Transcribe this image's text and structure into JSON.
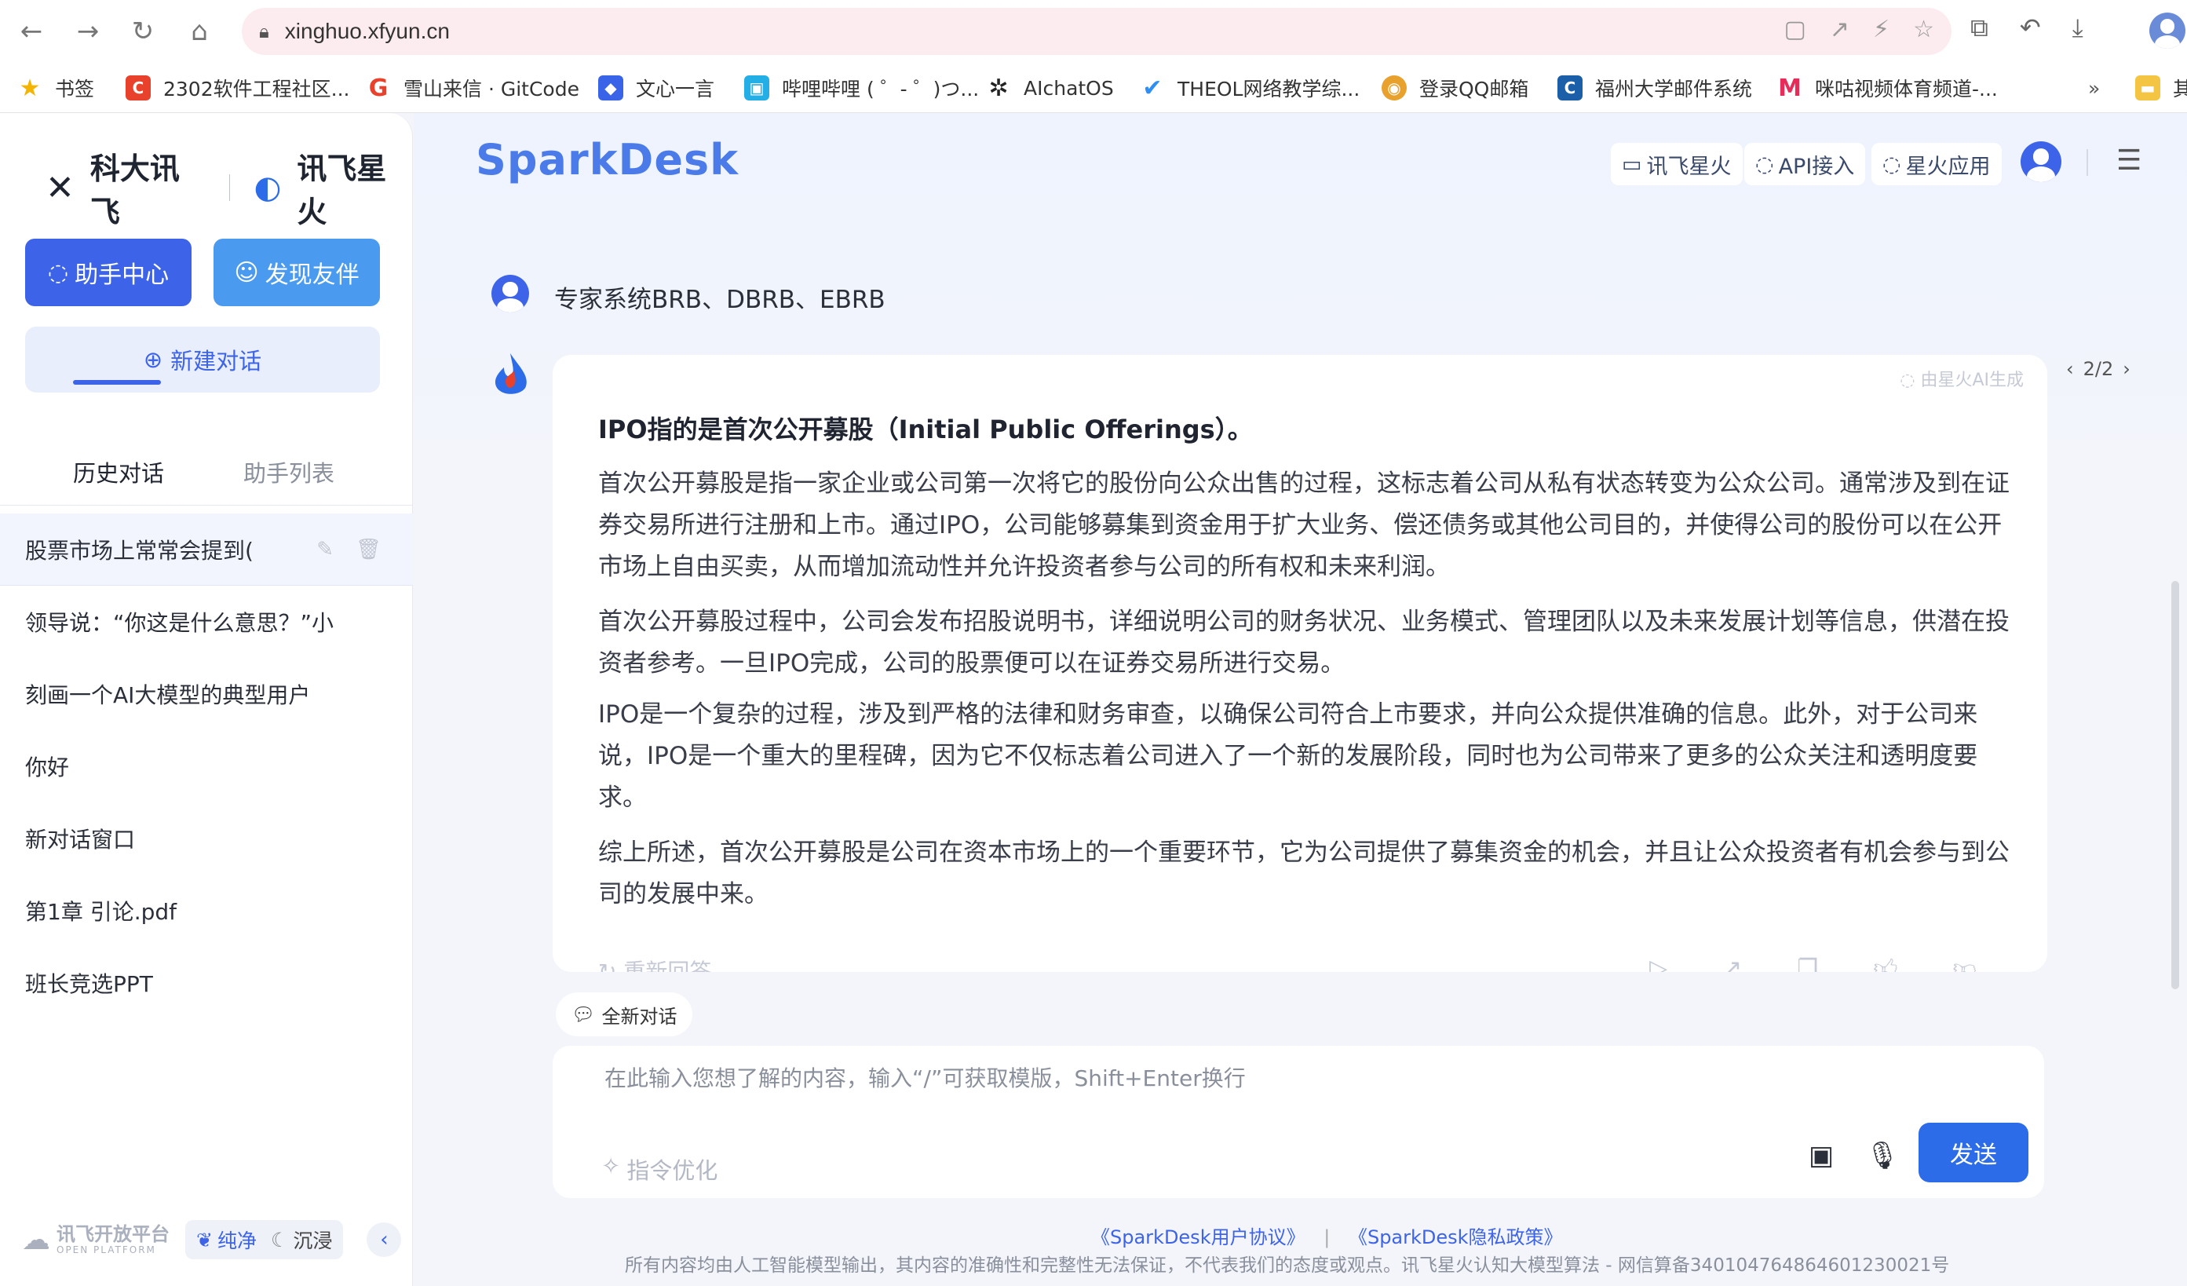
{
  "browser": {
    "url": "xinghuo.xfyun.cn",
    "bookmarks": [
      {
        "label": "书签",
        "icon": "star-icon",
        "color": "#f4b400"
      },
      {
        "label": "2302软件工程社区...",
        "icon": "c-logo-icon",
        "color": "#e8412c"
      },
      {
        "label": "雪山来信 · GitCode",
        "icon": "g-logo-icon",
        "color": "#e8412c"
      },
      {
        "label": "文心一言",
        "icon": "cube-icon",
        "color": "#3a64e8"
      },
      {
        "label": "哔哩哔哩 ( ゜- ゜)つ...",
        "icon": "bilibili-icon",
        "color": "#23aee5"
      },
      {
        "label": "AIchatOS",
        "icon": "openai-icon",
        "color": "#222222"
      },
      {
        "label": "THEOL网络教学综...",
        "icon": "check-icon",
        "color": "#2d8ef5"
      },
      {
        "label": "登录QQ邮箱",
        "icon": "chrome-icon",
        "color": "#e8a12c"
      },
      {
        "label": "福州大学邮件系统",
        "icon": "c-logo-icon",
        "color": "#1a5fa8"
      },
      {
        "label": "咪咕视频体育频道-...",
        "icon": "migu-icon",
        "color": "#e82c5a"
      }
    ],
    "more_label": "»",
    "folder_label": "其"
  },
  "sidebar": {
    "logo_text_1": "科大讯飞",
    "logo_text_2": "讯飞星火",
    "assistant_center": "助手中心",
    "discover": "发现友伴",
    "new_chat": "新建对话",
    "tab_history": "历史对话",
    "tab_assistants": "助手列表",
    "history": [
      "股票市场上常常会提到(",
      "领导说：“你这是什么意思？”小",
      "刻画一个AI大模型的典型用户",
      "你好",
      "新对话窗口",
      "第1章 引论.pdf",
      "班长竞选PPT"
    ],
    "platform_label": "讯飞开放平台",
    "platform_sub": "OPEN PLATFORM",
    "mode_pure": "纯净",
    "mode_immersive": "沉浸"
  },
  "header": {
    "brand": "SparkDesk",
    "links": [
      "讯飞星火",
      "API接入",
      "星火应用"
    ]
  },
  "chat": {
    "question": "专家系统BRB、DBRB、EBRB",
    "ai_tag": "由星火AI生成",
    "pager": "2/2",
    "answer_title": "IPO指的是首次公开募股（Initial Public Offerings）。",
    "paragraphs": [
      "首次公开募股是指一家企业或公司第一次将它的股份向公众出售的过程，这标志着公司从私有状态转变为公众公司。通常涉及到在证券交易所进行注册和上市。通过IPO，公司能够募集到资金用于扩大业务、偿还债务或其他公司目的，并使得公司的股份可以在公开市场上自由买卖，从而增加流动性并允许投资者参与公司的所有权和未来利润。",
      "首次公开募股过程中，公司会发布招股说明书，详细说明公司的财务状况、业务模式、管理团队以及未来发展计划等信息，供潜在投资者参考。一旦IPO完成，公司的股票便可以在证券交易所进行交易。",
      "IPO是一个复杂的过程，涉及到严格的法律和财务审查，以确保公司符合上市要求，并向公众提供准确的信息。此外，对于公司来说，IPO是一个重大的里程碑，因为它不仅标志着公司进入了一个新的发展阶段，同时也为公司带来了更多的公众关注和透明度要求。",
      "综上所述，首次公开募股是公司在资本市场上的一个重要环节，它为公司提供了募集资金的机会，并且让公众投资者有机会参与到公司的发展中来。"
    ],
    "regenerate": "重新回答"
  },
  "input": {
    "new_chat_pill": "全新对话",
    "placeholder": "在此输入您想了解的内容，输入“/”可获取模版，Shift+Enter换行",
    "optimize": "指令优化",
    "send": "发送"
  },
  "footer": {
    "agreement": "《SparkDesk用户协议》",
    "privacy": "《SparkDesk隐私政策》",
    "separator": "|",
    "note": "所有内容均由人工智能模型输出，其内容的准确性和完整性无法保证，不代表我们的态度或观点。讯飞星火认知大模型算法 - 网信算备340104764864601230021号"
  },
  "colors": {
    "accent": "#3d64e8",
    "discover_btn": "#4a9af0",
    "send_btn": "#2c6ce8"
  }
}
